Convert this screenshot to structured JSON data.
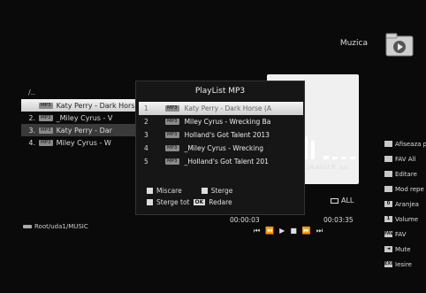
{
  "header": {
    "title": "Muzica",
    "icon": "folder-music-icon"
  },
  "browser": {
    "up_label": "/..",
    "items": [
      {
        "num": "1.",
        "badge": "MP3",
        "title": "Katy Perry - Dark Horse"
      },
      {
        "num": "2.",
        "badge": "MP3",
        "title": "_Miley Cyrus - V"
      },
      {
        "num": "3.",
        "badge": "MP3",
        "title": "Katy Perry - Dar"
      },
      {
        "num": "4.",
        "badge": "MP3",
        "title": "Miley Cyrus - W"
      }
    ],
    "root_path": "Root/uda1/MUSIC"
  },
  "playlist": {
    "title": "PlayList MP3",
    "items": [
      {
        "num": "1",
        "badge": "MP3",
        "title": "Katy Perry - Dark Horse (A"
      },
      {
        "num": "2",
        "badge": "MP3",
        "title": "Miley Cyrus - Wrecking Ba"
      },
      {
        "num": "3",
        "badge": "MP3",
        "title": "Holland's Got Talent 2013"
      },
      {
        "num": "4",
        "badge": "MP3",
        "title": "_Miley Cyrus - Wrecking"
      },
      {
        "num": "5",
        "badge": "MP3",
        "title": "_Holland's Got Talent 201"
      }
    ],
    "actions": {
      "move": "Miscare",
      "delete": "Sterge",
      "delete_all": "Sterge tot",
      "ok_key": "OK",
      "play": "Redare"
    }
  },
  "player": {
    "song_info": "orse (Audio) ft. Jui",
    "repeat": "ALL",
    "time_start": "00:00:03",
    "time_end": "00:03:35",
    "bars": [
      0.45,
      0.55,
      1.0,
      0.8,
      0.15,
      0.1,
      0.12,
      0.1
    ]
  },
  "side_menu": [
    {
      "key": "",
      "label": "Afiseaza p"
    },
    {
      "key": "",
      "label": "FAV All"
    },
    {
      "key": "",
      "label": "Editare"
    },
    {
      "key": "",
      "label": "Mod repe"
    },
    {
      "key": "0",
      "label": "Aranjea"
    },
    {
      "key": "1",
      "label": "Volume"
    },
    {
      "key": "FAV",
      "label": "FAV"
    },
    {
      "key": "◄",
      "label": "Mute"
    },
    {
      "key": "EXIT",
      "label": "Iesire"
    }
  ],
  "colors": {
    "background": "#0a0a0a",
    "selection": "#e6e6e6",
    "text": "#e8e8e8"
  }
}
